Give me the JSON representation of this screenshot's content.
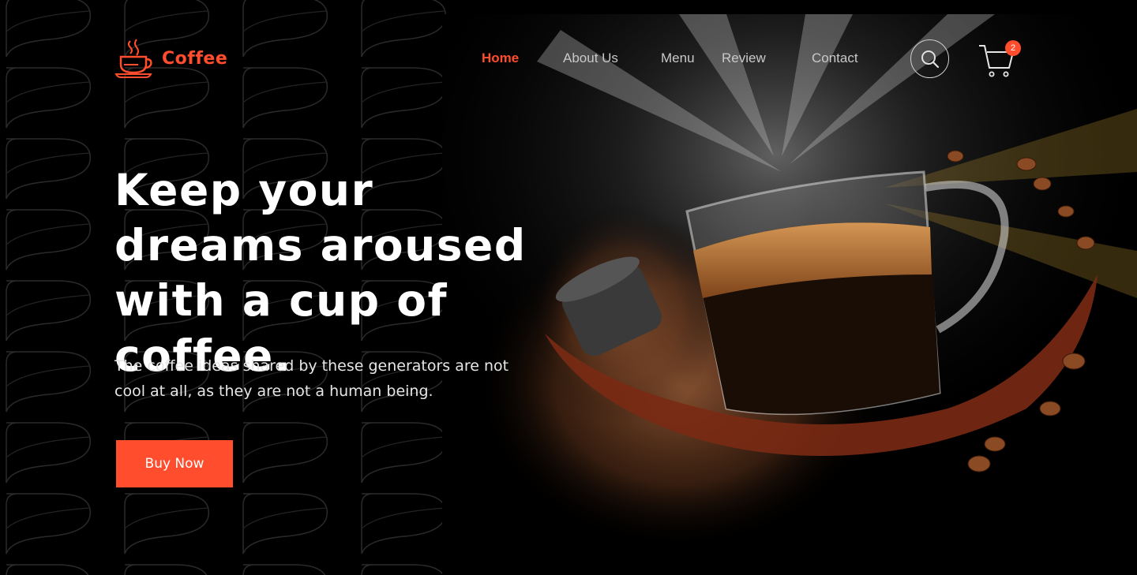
{
  "brand": {
    "name": "Coffee",
    "icon": "coffee-cup-icon"
  },
  "nav": {
    "items": [
      {
        "label": "Home",
        "active": true
      },
      {
        "label": "About Us",
        "active": false
      },
      {
        "label": "Menu",
        "active": false
      },
      {
        "label": "Review",
        "active": false
      },
      {
        "label": "Contact",
        "active": false
      }
    ]
  },
  "header": {
    "search_icon": "search-icon",
    "cart_icon": "cart-icon",
    "cart_count": "2"
  },
  "hero": {
    "headline": "Keep your dreams aroused with a cup of coffee.",
    "subtext": "The coffee ideas shared by these generators are not cool at all, as they are not a human being.",
    "cta_label": "Buy Now"
  },
  "colors": {
    "accent": "#ff4d2e",
    "background": "#000000",
    "text": "#ffffff",
    "nav_text": "#c9c9c9"
  }
}
